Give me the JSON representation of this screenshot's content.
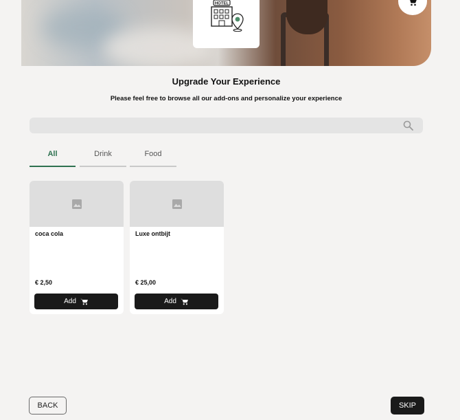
{
  "header": {
    "hero_image": "hotel-guest-with-luggage-photo",
    "logo_text": "HOTEL",
    "logo_icon": "hotel-building-location-icon",
    "cart_icon": "cart-icon"
  },
  "page": {
    "title": "Upgrade Your Experience",
    "subtitle": "Please feel free to browse all our add-ons and personalize your experience"
  },
  "search": {
    "placeholder": "",
    "value": "",
    "icon": "search-icon"
  },
  "tabs": [
    {
      "label": "All",
      "active": true
    },
    {
      "label": "Drink",
      "active": false
    },
    {
      "label": "Food",
      "active": false
    }
  ],
  "products": [
    {
      "name": "coca cola",
      "price": "€ 2,50",
      "button_label": "Add",
      "image": "image-placeholder-icon"
    },
    {
      "name": "Luxe ontbijt",
      "price": "€ 25,00",
      "button_label": "Add",
      "image": "image-placeholder-icon"
    }
  ],
  "footer": {
    "back_label": "BACK",
    "skip_label": "SKIP"
  },
  "colors": {
    "accent": "#2e7150",
    "button_dark": "#1a1a1a",
    "background": "#f4f3f2",
    "search_bg": "#e4e4e4",
    "image_placeholder": "#dedede"
  }
}
